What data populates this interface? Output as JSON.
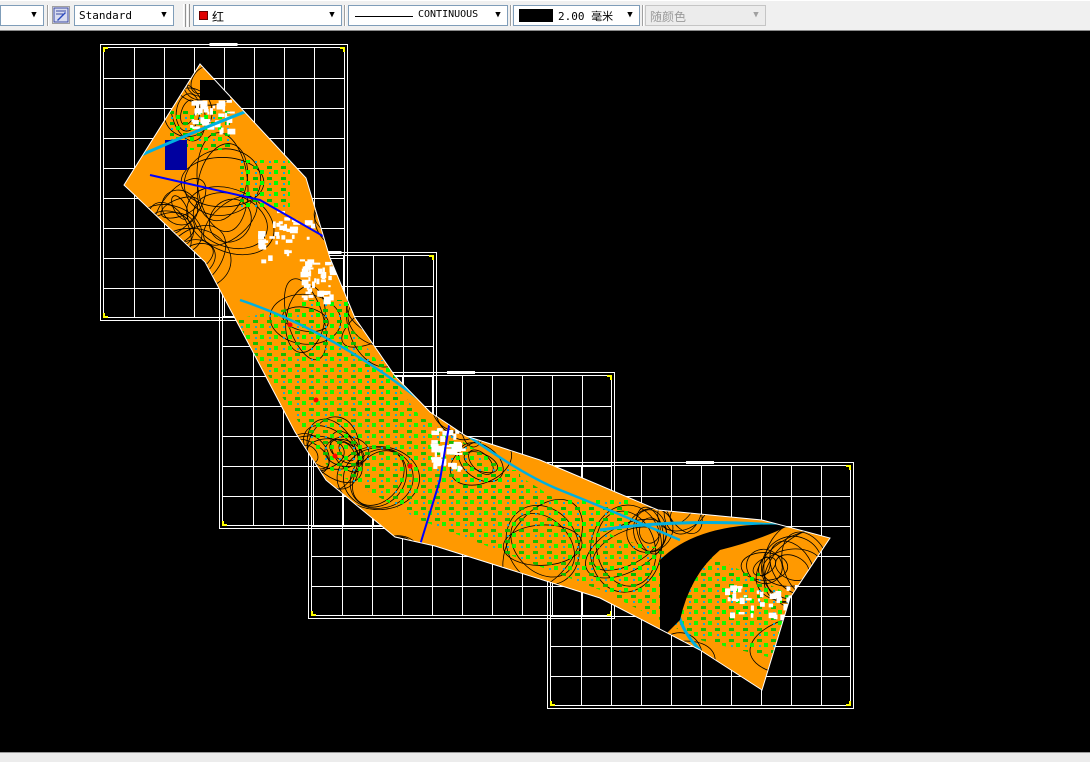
{
  "toolbar": {
    "text_style": "Standard",
    "color": {
      "label": "红",
      "swatch": "#e00000"
    },
    "linetype": "CONTINUOUS",
    "lineweight": "2.00 毫米",
    "plot_style": "随颜色"
  },
  "drawing": {
    "background": "#000000",
    "sheet_border_color": "#ffffff",
    "corner_mark_color": "#ffff00",
    "map_colors": {
      "terrain": "#ff9900",
      "vegetation": "#00c000",
      "bright_vegetation": "#00ff00",
      "water": "#00b0e0",
      "roads_blue": "#0000ff",
      "contours": "#000000",
      "built_area": "#ffffff",
      "marker": "#ff0000"
    }
  }
}
